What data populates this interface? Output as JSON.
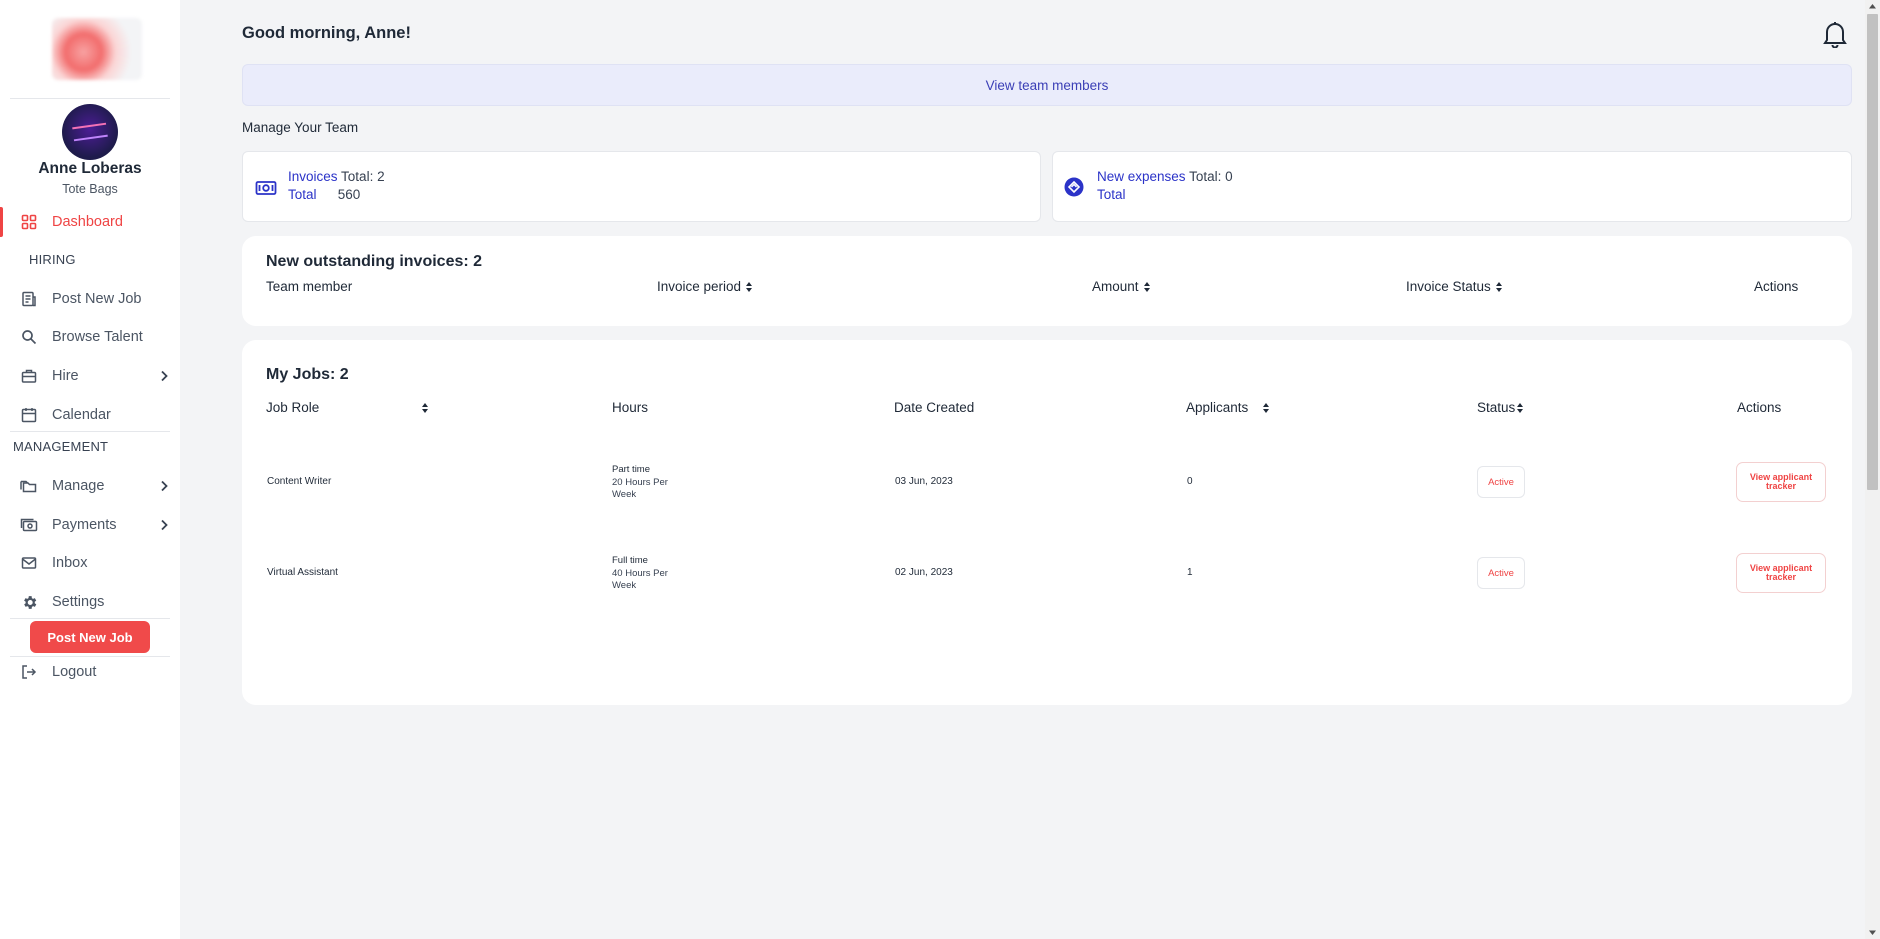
{
  "sidebar": {
    "user": {
      "name": "Anne Loberas",
      "company": "Tote Bags"
    },
    "items": {
      "dashboard": "Dashboard",
      "hiring_header": "HIRING",
      "post_new_job": "Post New Job",
      "browse_talent": "Browse Talent",
      "hire": "Hire",
      "calendar": "Calendar",
      "management_header": "MANAGEMENT",
      "manage": "Manage",
      "payments": "Payments",
      "inbox": "Inbox",
      "settings": "Settings",
      "logout": "Logout"
    },
    "post_job_button": "Post New Job",
    "accent_color": "#ef4444"
  },
  "header": {
    "greeting": "Good morning, Anne!",
    "view_team_label": "View team members",
    "manage_label": "Manage Your Team"
  },
  "stats": {
    "invoices": {
      "label": "Invoices",
      "total_count": "Total: 2",
      "total_label": "Total",
      "total_value": "560"
    },
    "expenses": {
      "label": "New expenses",
      "total_count": "Total: 0",
      "total_label": "Total"
    }
  },
  "outstanding": {
    "title": "New outstanding invoices: 2",
    "columns": [
      "Team member",
      "Invoice period",
      "Amount",
      "Invoice Status",
      "Actions"
    ]
  },
  "jobs": {
    "title": "My Jobs: 2",
    "columns": [
      "Job Role",
      "Hours",
      "Date Created",
      "Applicants",
      "Status",
      "Actions"
    ],
    "rows": [
      {
        "role": "Content Writer",
        "hours_type": "Part time",
        "hours_detail": "20 Hours Per Week",
        "date": "03 Jun, 2023",
        "applicants": "0",
        "status": "Active",
        "action": "View applicant tracker"
      },
      {
        "role": "Virtual Assistant",
        "hours_type": "Full time",
        "hours_detail": "40 Hours Per Week",
        "date": "02 Jun, 2023",
        "applicants": "1",
        "status": "Active",
        "action": "View applicant tracker"
      }
    ]
  }
}
